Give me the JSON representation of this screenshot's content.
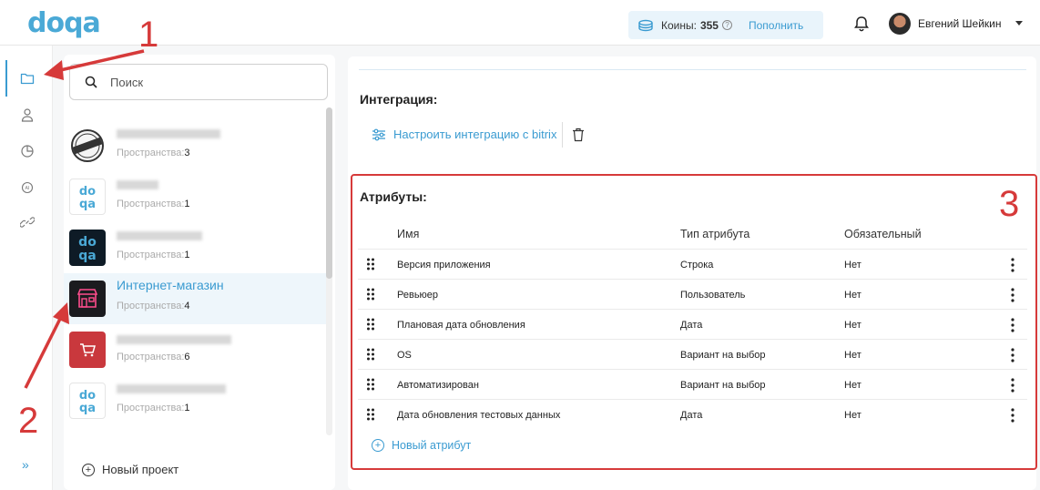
{
  "header": {
    "logo": "doqa",
    "coins_label": "Коины:",
    "coins_value": "355",
    "topup_label": "Пополнить",
    "user_name": "Евгений Шейкин"
  },
  "rail": {
    "expand_label": "»"
  },
  "search": {
    "placeholder": "Поиск"
  },
  "projects": [
    {
      "name": "",
      "spaces_label": "Пространства:",
      "spaces": "3",
      "logo": "top-secret-stamp"
    },
    {
      "name": "",
      "spaces_label": "Пространства:",
      "spaces": "1",
      "logo": "doqa-light"
    },
    {
      "name": "",
      "spaces_label": "Пространства:",
      "spaces": "1",
      "logo": "doqa-dark"
    },
    {
      "name": "Интернет-магазин",
      "spaces_label": "Пространства:",
      "spaces": "4",
      "logo": "shop-neon"
    },
    {
      "name": "",
      "spaces_label": "Пространства:",
      "spaces": "6",
      "logo": "cart-red"
    },
    {
      "name": "",
      "spaces_label": "Пространства:",
      "spaces": "1",
      "logo": "doqa-light"
    }
  ],
  "new_project_label": "Новый проект",
  "integration": {
    "title": "Интеграция:",
    "configure_label": "Настроить интеграцию с bitrix"
  },
  "attributes": {
    "title": "Атрибуты:",
    "columns": [
      "Имя",
      "Тип атрибута",
      "Обязательный"
    ],
    "rows": [
      {
        "name": "Версия приложения",
        "type": "Строка",
        "required": "Нет"
      },
      {
        "name": "Ревьюер",
        "type": "Пользователь",
        "required": "Нет"
      },
      {
        "name": "Плановая дата обновления",
        "type": "Дата",
        "required": "Нет"
      },
      {
        "name": "OS",
        "type": "Вариант на выбор",
        "required": "Нет"
      },
      {
        "name": "Автоматизирован",
        "type": "Вариант на выбор",
        "required": "Нет"
      },
      {
        "name": "Дата обновления тестовых данных",
        "type": "Дата",
        "required": "Нет"
      }
    ],
    "new_attribute_label": "Новый атрибут"
  },
  "annotations": {
    "label_1": "1",
    "label_2": "2",
    "label_3": "3",
    "color": "#d63a3a"
  },
  "colors": {
    "accent": "#3a9bd1",
    "annotation": "#d63a3a"
  }
}
